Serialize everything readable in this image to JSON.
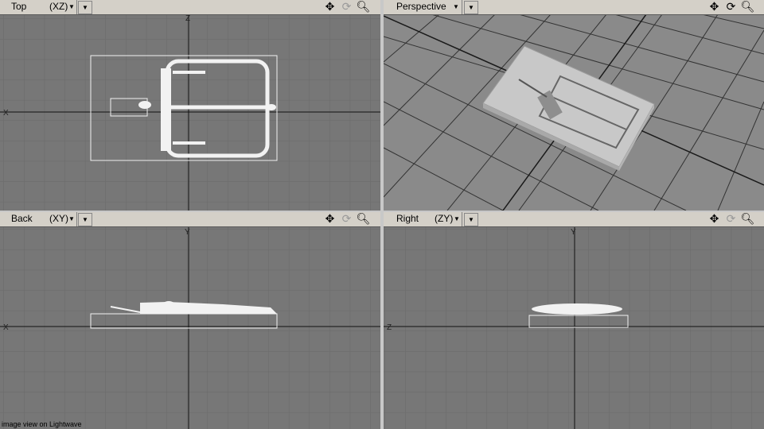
{
  "viewports": [
    {
      "id": "top",
      "title": "Top",
      "axes": "(XZ)"
    },
    {
      "id": "perspective",
      "title": "Perspective",
      "axes": ""
    },
    {
      "id": "back",
      "title": "Back",
      "axes": "(XY)"
    },
    {
      "id": "right",
      "title": "Right",
      "axes": "(ZY)"
    }
  ],
  "axis_labels": {
    "x": "X",
    "y": "Y",
    "z": "Z"
  },
  "icons": {
    "move": "move-icon",
    "rotate": "rotate-icon",
    "zoom": "zoom-icon",
    "dropdown": "chevron-down-icon"
  },
  "status": {
    "caption": "image view on Lightwave"
  },
  "colors": {
    "viewport_bg": "#777777",
    "grid": "#6c6c6c",
    "axis": "#1a1a1a",
    "wire": "#f2f2f2",
    "bar": "#d4d0c8"
  }
}
